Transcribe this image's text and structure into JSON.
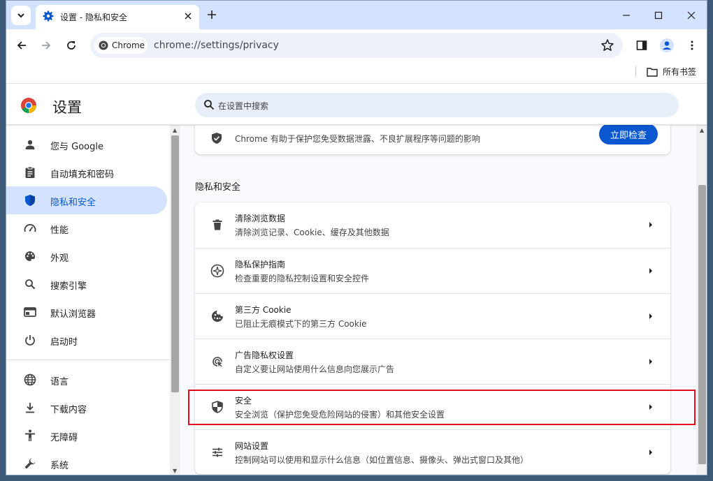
{
  "window": {
    "tab_title": "设置 - 隐私和安全",
    "chip_label": "Chrome",
    "url": "chrome://settings/privacy",
    "bookmarks_label": "所有书签"
  },
  "settings": {
    "title": "设置",
    "search_placeholder": "在设置中搜索"
  },
  "sidebar": {
    "items": [
      {
        "label": "您与 Google",
        "icon": "person-icon"
      },
      {
        "label": "自动填充和密码",
        "icon": "clipboard-icon"
      },
      {
        "label": "隐私和安全",
        "icon": "shield-icon",
        "active": true
      },
      {
        "label": "性能",
        "icon": "speedometer-icon"
      },
      {
        "label": "外观",
        "icon": "palette-icon"
      },
      {
        "label": "搜索引擎",
        "icon": "search-icon"
      },
      {
        "label": "默认浏览器",
        "icon": "browser-icon"
      },
      {
        "label": "启动时",
        "icon": "power-icon"
      },
      {
        "label": "语言",
        "icon": "globe-icon"
      },
      {
        "label": "下载内容",
        "icon": "download-icon"
      },
      {
        "label": "无障碍",
        "icon": "accessibility-icon"
      },
      {
        "label": "系统",
        "icon": "wrench-icon"
      }
    ]
  },
  "main": {
    "safety_check": {
      "text": "Chrome 有助于保护您免受数据泄露、不良扩展程序等问题的影响",
      "button": "立即检查"
    },
    "section_title": "隐私和安全",
    "rows": [
      {
        "title": "清除浏览数据",
        "subtitle": "清除浏览记录、Cookie、缓存及其他数据",
        "icon": "trash-icon"
      },
      {
        "title": "隐私保护指南",
        "subtitle": "检查重要的隐私控制设置和安全控件",
        "icon": "compass-icon"
      },
      {
        "title": "第三方 Cookie",
        "subtitle": "已阻止无痕模式下的第三方 Cookie",
        "icon": "cookie-icon"
      },
      {
        "title": "广告隐私权设置",
        "subtitle": "自定义要让网站使用什么信息向您展示广告",
        "icon": "ads-icon"
      },
      {
        "title": "安全",
        "subtitle": "安全浏览（保护您免受危险网站的侵害）和其他安全设置",
        "icon": "security-shield-icon"
      },
      {
        "title": "网站设置",
        "subtitle": "控制网站可以使用和显示什么信息（如位置信息、摄像头、弹出式窗口及其他）",
        "icon": "sliders-icon"
      }
    ]
  },
  "colors": {
    "accent": "#0b57d0",
    "highlight": "#e00d1f"
  }
}
